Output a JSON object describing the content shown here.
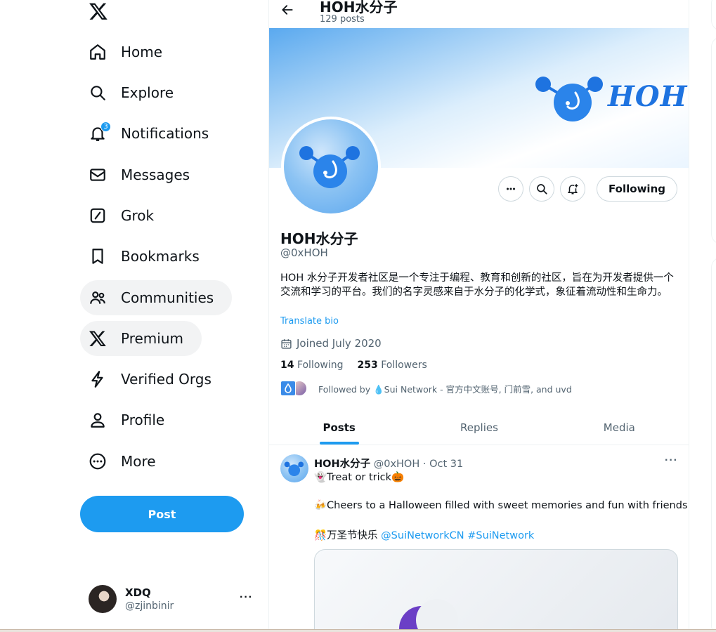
{
  "nav": {
    "items": [
      {
        "label": "Home",
        "icon": "home-icon"
      },
      {
        "label": "Explore",
        "icon": "search-icon"
      },
      {
        "label": "Notifications",
        "icon": "bell-icon",
        "badge": "3"
      },
      {
        "label": "Messages",
        "icon": "envelope-icon"
      },
      {
        "label": "Grok",
        "icon": "grok-icon"
      },
      {
        "label": "Bookmarks",
        "icon": "bookmark-icon"
      },
      {
        "label": "Communities",
        "icon": "people-icon"
      },
      {
        "label": "Premium",
        "icon": "x-logo-icon"
      },
      {
        "label": "Verified Orgs",
        "icon": "lightning-icon"
      },
      {
        "label": "Profile",
        "icon": "person-icon"
      },
      {
        "label": "More",
        "icon": "more-circle-icon"
      }
    ],
    "post_label": "Post"
  },
  "account": {
    "name": "XDQ",
    "handle": "@zjinbinir",
    "more": "···"
  },
  "header": {
    "title": "HOH水分子",
    "posts_count": "129 posts"
  },
  "banner": {
    "brand_text": "HOH"
  },
  "profile": {
    "name": "HOH水分子",
    "handle": "@0xHOH",
    "bio": "HOH 水分子开发者社区是一个专注于编程、教育和创新的社区，旨在为开发者提供一个交流和学习的平台。我们的名字灵感来自于水分子的化学式，象征着流动性和生命力。",
    "translate_label": "Translate bio",
    "joined": "Joined July 2020",
    "following_count": "14",
    "following_label": "Following",
    "followers_count": "253",
    "followers_label": "Followers",
    "followed_by": "Followed by 💧Sui Network - 官方中文账号, 门前雪, and uvd",
    "following_button": "Following"
  },
  "tabs": [
    {
      "label": "Posts",
      "active": true
    },
    {
      "label": "Replies",
      "active": false
    },
    {
      "label": "Media",
      "active": false
    }
  ],
  "tweet": {
    "author": "HOH水分子",
    "meta": "@0xHOH · Oct 31",
    "more": "···",
    "line1": "👻Treat or trick🎃",
    "line2": "🍻Cheers to a Halloween filled with sweet memories and fun with friends!",
    "line3_text": "🎊万圣节快乐 ",
    "line3_mention": "@SuiNetworkCN",
    "line3_hashtag": "#SuiNetwork"
  },
  "colors": {
    "accent": "#1d9bf0",
    "text": "#0f1419",
    "muted": "#536471",
    "border": "#cfd9de"
  }
}
